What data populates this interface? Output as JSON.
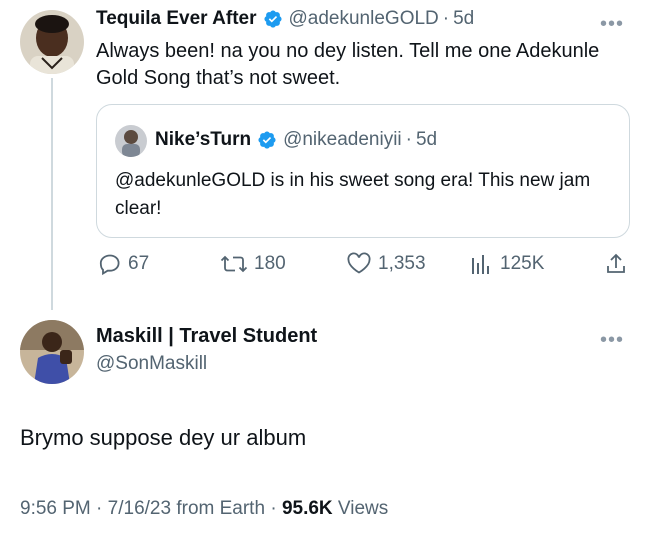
{
  "tweet": {
    "name": "Tequila Ever After",
    "handle": "@adekunleGOLD",
    "dot": "·",
    "time": "5d",
    "text": "Always been! na you no dey listen. Tell me one Adekunle Gold Song that’s not sweet.",
    "more": "•••"
  },
  "quote": {
    "name": "Nike’sTurn",
    "handle": "@nikeadeniyii",
    "dot": "·",
    "time": "5d",
    "text": "@adekunleGOLD is in his sweet song era! This new jam clear!"
  },
  "actions": {
    "replies": "67",
    "retweets": "180",
    "likes": "1,353",
    "views": "125K"
  },
  "reply": {
    "name": "Maskill | Travel Student",
    "handle": "@SonMaskill",
    "text": "Brymo suppose dey ur album",
    "more": "•••"
  },
  "meta": {
    "time": "9:56 PM",
    "sep1": " · ",
    "date": "7/16/23",
    "source": " from Earth",
    "sep2": " · ",
    "views_count": "95.6K",
    "views_label": " Views"
  },
  "colors": {
    "verified": "#1d9bf0",
    "secondary_text": "#536471",
    "border": "#cfd9de"
  }
}
